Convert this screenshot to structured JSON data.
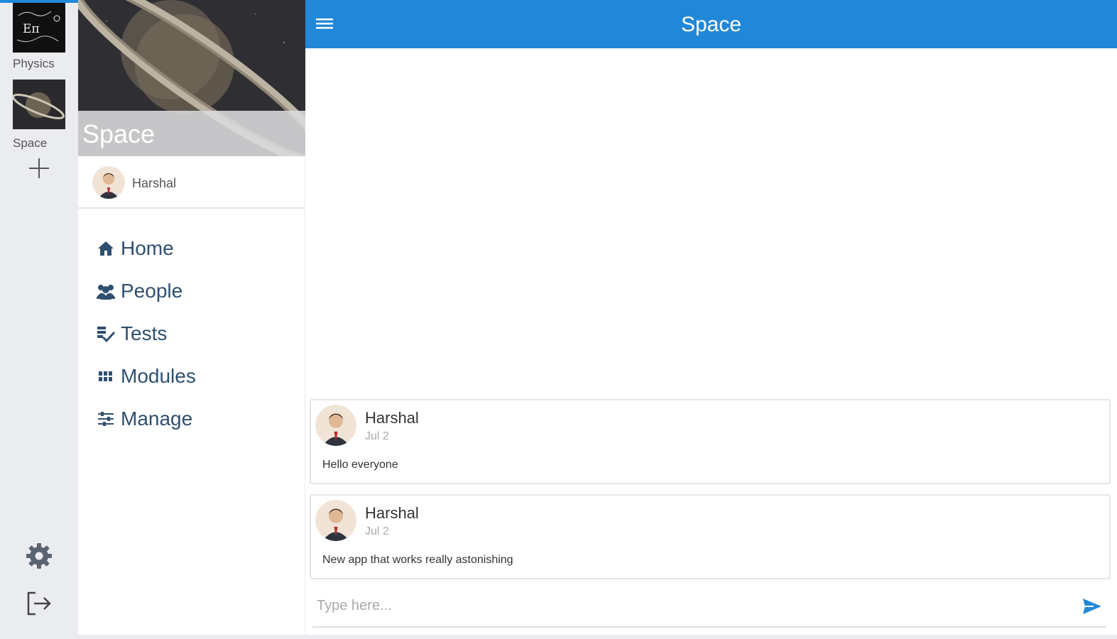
{
  "rail": {
    "classes": [
      {
        "label": "Physics",
        "thumb_text": "Eπ"
      },
      {
        "label": "Space"
      }
    ],
    "add_label": "+"
  },
  "drawer": {
    "cover_title": "Space",
    "owner_name": "Harshal",
    "nav": [
      {
        "label": "Home",
        "icon": "home-icon"
      },
      {
        "label": "People",
        "icon": "people-icon"
      },
      {
        "label": "Tests",
        "icon": "tests-icon"
      },
      {
        "label": "Modules",
        "icon": "modules-icon"
      },
      {
        "label": "Manage",
        "icon": "manage-icon"
      }
    ]
  },
  "topbar": {
    "title": "Space"
  },
  "posts": [
    {
      "author": "Harshal",
      "date": "Jul 2",
      "text": "Hello everyone"
    },
    {
      "author": "Harshal",
      "date": "Jul 2",
      "text": "New app that works really astonishing"
    }
  ],
  "composer": {
    "placeholder": "Type here..."
  },
  "colors": {
    "primary": "#2188d8",
    "nav_text": "#2f4f6f",
    "rail_bg": "#eaecef"
  }
}
